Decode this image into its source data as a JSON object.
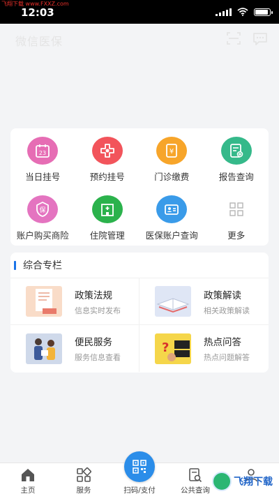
{
  "watermark": {
    "top_text": "飞翔下载 www.FXXZ.com",
    "logo_text": "飞翔下载"
  },
  "status": {
    "time": "12:03",
    "battery_level": 0.9
  },
  "header": {
    "title": "微信医保",
    "icons": [
      "scan-icon",
      "message-icon"
    ]
  },
  "services": [
    {
      "label": "当日挂号",
      "icon": "calendar-icon",
      "color": "#e66db4"
    },
    {
      "label": "预约挂号",
      "icon": "medical-cross-icon",
      "color": "#f2545b"
    },
    {
      "label": "门诊缴费",
      "icon": "bill-icon",
      "color": "#f7a52a"
    },
    {
      "label": "报告查询",
      "icon": "report-icon",
      "color": "#35b98a"
    },
    {
      "label": "账户购买商险",
      "icon": "insurance-shield-icon",
      "color": "#e474c0"
    },
    {
      "label": "住院管理",
      "icon": "hospital-icon",
      "color": "#2bb24c"
    },
    {
      "label": "医保账户查询",
      "icon": "id-card-icon",
      "color": "#3a9be9"
    },
    {
      "label": "更多",
      "icon": "more-grid-icon",
      "color": "#b5b5b5"
    }
  ],
  "column": {
    "title": "综合专栏",
    "accent_color": "#1a73e8",
    "items": [
      {
        "title": "政策法规",
        "subtitle": "信息实时发布",
        "thumb": "policy-document-image"
      },
      {
        "title": "政策解读",
        "subtitle": "相关政策解读",
        "thumb": "open-book-image"
      },
      {
        "title": "便民服务",
        "subtitle": "服务信息查看",
        "thumb": "service-people-image"
      },
      {
        "title": "热点问答",
        "subtitle": "热点问题解答",
        "thumb": "question-mark-image"
      }
    ]
  },
  "tabs": [
    {
      "label": "主页",
      "icon": "home-icon"
    },
    {
      "label": "服务",
      "icon": "services-icon"
    },
    {
      "label": "扫码/支付",
      "icon": "qrcode-icon"
    },
    {
      "label": "公共查询",
      "icon": "search-doc-icon"
    },
    {
      "label": "",
      "icon": "profile-icon"
    }
  ]
}
